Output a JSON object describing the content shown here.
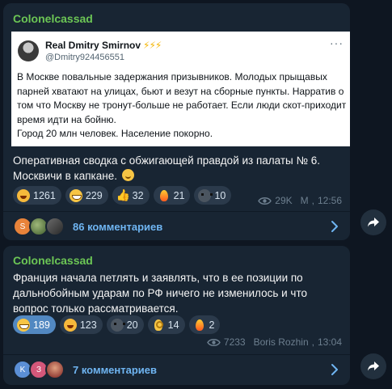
{
  "messages": [
    {
      "channel": "Colonelcassad",
      "embed": {
        "author_name": "Real Dmitry Smirnov",
        "author_badge": "⚡⚡⚡",
        "author_handle": "@Dmitry924456551",
        "more": "···",
        "text": "В Москве повальные задержания призывников. Молодых прыщавых парней хватают на улицах, бьют и везут на сборные пункты. Нарратив о том что Москву не тронут-больше не работает. Если люди скот-приходит время идти на бойню.\nГород 20 млн человек. Население покорно."
      },
      "text": "Оперативная сводка с обжигающей правдой из палаты № 6. Москвичи в капкане.",
      "reactions": [
        {
          "emoji": "rofl",
          "count": "1261"
        },
        {
          "emoji": "grin",
          "count": "229"
        },
        {
          "emoji": "thumbs-up",
          "count": "32"
        },
        {
          "emoji": "fire",
          "count": "21"
        },
        {
          "emoji": "skull",
          "count": "10"
        }
      ],
      "views": "29K",
      "author": "M",
      "time": "12:56",
      "comments": "86 комментариев",
      "comment_avatars": [
        "S",
        "",
        ""
      ]
    },
    {
      "channel": "Colonelcassad",
      "text": "Франция начала петлять и заявлять, что в ее позиции по дальнобойным ударам по РФ ничего не изменилось и что вопрос только рассматривается.",
      "reactions": [
        {
          "emoji": "grin",
          "count": "189",
          "active": true
        },
        {
          "emoji": "rofl",
          "count": "123"
        },
        {
          "emoji": "skull",
          "count": "20"
        },
        {
          "emoji": "ok-hand",
          "count": "14"
        },
        {
          "emoji": "fire",
          "count": "2"
        }
      ],
      "views": "7233",
      "author": "Boris Rozhin",
      "time": "13:04",
      "comments": "7 комментариев",
      "comment_avatars": [
        "K",
        "З",
        ""
      ]
    }
  ],
  "colors": {
    "background": "#0e1621",
    "bubble": "#182533",
    "channel_name": "#6cc655",
    "link": "#6fb5f2",
    "reaction": "#2b3a4b",
    "reaction_active": "#5288c1"
  }
}
